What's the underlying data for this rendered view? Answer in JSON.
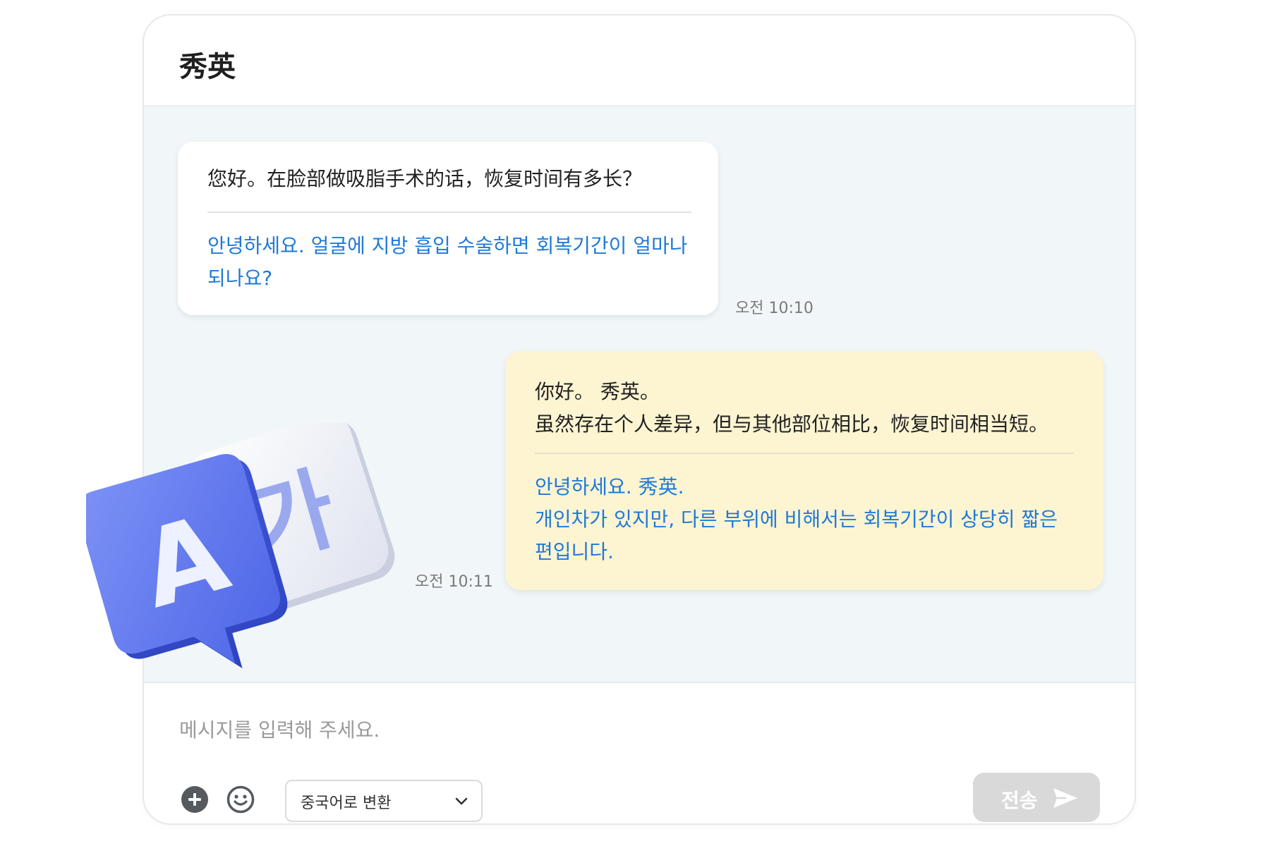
{
  "header": {
    "title": "秀英"
  },
  "messages": [
    {
      "direction": "incoming",
      "original": [
        "您好。在脸部做吸脂手术的话，恢复时间有多长？"
      ],
      "translation": [
        "안녕하세요. 얼굴에 지방 흡입 수술하면 회복기간이 얼마나",
        "되나요?"
      ],
      "time": "오전 10:10"
    },
    {
      "direction": "outgoing",
      "original": [
        "你好。 秀英。",
        "虽然存在个人差异，但与其他部位相比，恢复时间相当短。"
      ],
      "translation": [
        "안녕하세요. 秀英.",
        "개인차가 있지만, 다른 부위에 비해서는 회복기간이 상당히 짧은",
        "편입니다."
      ],
      "time": "오전 10:11"
    }
  ],
  "composer": {
    "placeholder": "메시지를 입력해 주세요.",
    "translate_select": {
      "selected": "중국어로 변환"
    },
    "send_label": "전송"
  },
  "badge": {
    "left_glyph": "A",
    "right_glyph": "가"
  },
  "icons": {
    "attach": "plus-circle-icon",
    "emoji": "smiley-icon",
    "dropdown": "chevron-down-icon",
    "send": "paper-plane-icon",
    "badge": "translate-icon"
  },
  "colors": {
    "translation_text": "#1f7ad6",
    "incoming_bubble": "#ffffff",
    "outgoing_bubble": "#fdf4d2",
    "chat_background": "#f1f6f8",
    "send_disabled": "#d9d9d9",
    "badge_blue": "#5b74ec"
  }
}
